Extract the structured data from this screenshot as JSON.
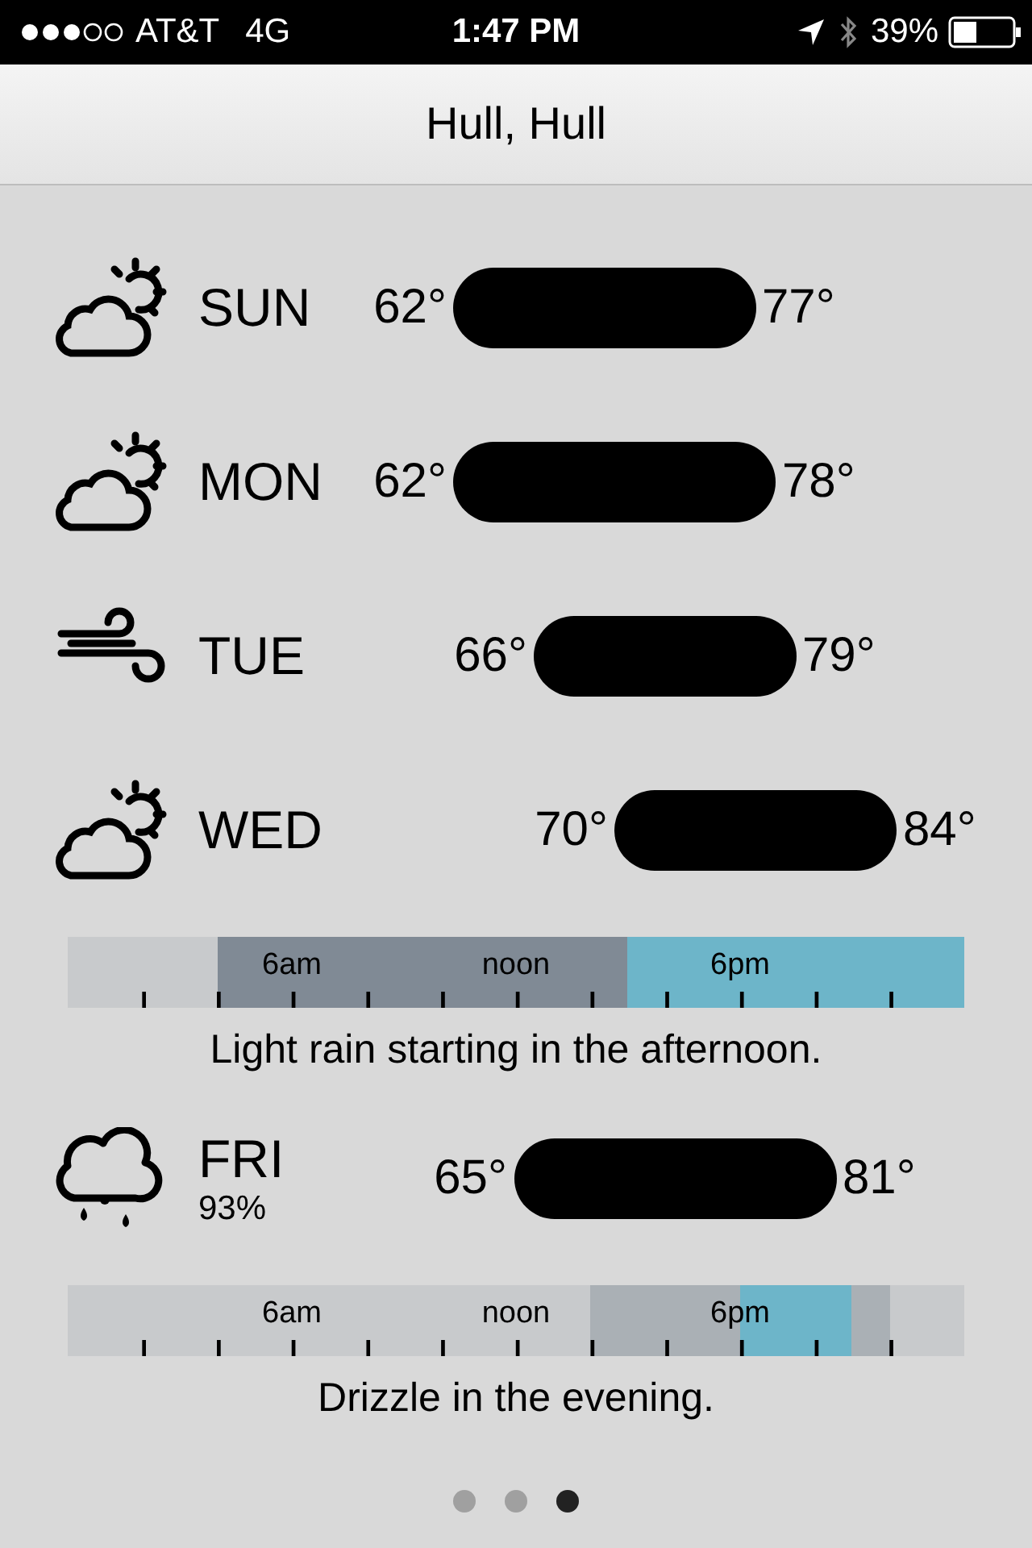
{
  "status_bar": {
    "carrier": "AT&T",
    "network": "4G",
    "time": "1:47 PM",
    "battery": "39%"
  },
  "header": {
    "title": "Hull, Hull"
  },
  "days": [
    {
      "kind": "partly-cloudy",
      "name": "SUN",
      "low": "62°",
      "high": "77°"
    },
    {
      "kind": "partly-cloudy",
      "name": "MON",
      "low": "62°",
      "high": "78°"
    },
    {
      "kind": "wind",
      "name": "TUE",
      "low": "66°",
      "high": "79°"
    },
    {
      "kind": "partly-cloudy",
      "name": "WED",
      "low": "70°",
      "high": "84°",
      "timeline": {
        "hour_labels": [
          "6am",
          "noon",
          "6pm"
        ],
        "summary": "Light rain starting in the afternoon.",
        "hours": [
          {
            "kind": "clear"
          },
          {
            "kind": "clear"
          },
          {
            "kind": "clear"
          },
          {
            "kind": "clear"
          },
          {
            "kind": "cloudy"
          },
          {
            "kind": "cloudy"
          },
          {
            "kind": "cloudy"
          },
          {
            "kind": "cloudy"
          },
          {
            "kind": "cloudy"
          },
          {
            "kind": "cloudy"
          },
          {
            "kind": "cloudy"
          },
          {
            "kind": "cloudy"
          },
          {
            "kind": "cloudy"
          },
          {
            "kind": "cloudy"
          },
          {
            "kind": "cloudy"
          },
          {
            "kind": "rain"
          },
          {
            "kind": "rain"
          },
          {
            "kind": "rain"
          },
          {
            "kind": "rain"
          },
          {
            "kind": "rain"
          },
          {
            "kind": "rain"
          },
          {
            "kind": "rain"
          },
          {
            "kind": "rain"
          },
          {
            "kind": "rain"
          }
        ]
      }
    },
    {
      "kind": "rain",
      "name": "FRI",
      "precip": "93%",
      "low": "65°",
      "high": "81°",
      "timeline": {
        "hour_labels": [
          "6am",
          "noon",
          "6pm"
        ],
        "summary": "Drizzle in the evening.",
        "hours": [
          {
            "kind": "clear"
          },
          {
            "kind": "clear"
          },
          {
            "kind": "clear"
          },
          {
            "kind": "clear"
          },
          {
            "kind": "clear"
          },
          {
            "kind": "clear"
          },
          {
            "kind": "clear"
          },
          {
            "kind": "clear"
          },
          {
            "kind": "clear"
          },
          {
            "kind": "clear"
          },
          {
            "kind": "clear"
          },
          {
            "kind": "clear"
          },
          {
            "kind": "clear"
          },
          {
            "kind": "clear"
          },
          {
            "kind": "partly"
          },
          {
            "kind": "partly"
          },
          {
            "kind": "partly"
          },
          {
            "kind": "partly"
          },
          {
            "kind": "rain"
          },
          {
            "kind": "rain"
          },
          {
            "kind": "rain"
          },
          {
            "kind": "partly"
          },
          {
            "kind": "clear"
          },
          {
            "kind": "clear"
          }
        ]
      }
    }
  ],
  "pages": [
    {
      "selected": false
    },
    {
      "selected": false
    },
    {
      "selected": true
    }
  ]
}
